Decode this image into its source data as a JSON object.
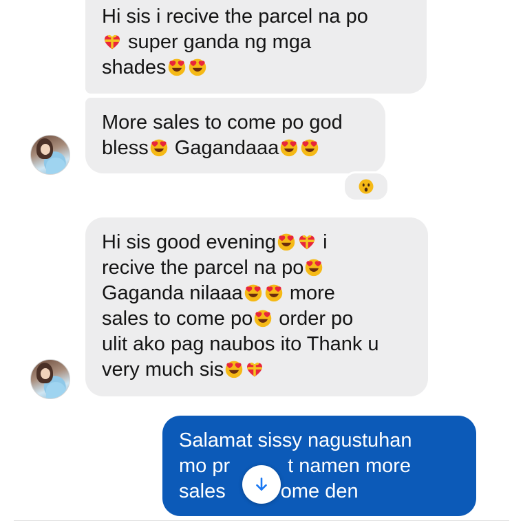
{
  "conversation": {
    "messages": [
      {
        "sender": "contact",
        "lines": [
          "Hi sis i recive the parcel na po",
          " super ganda ng mga",
          "shades"
        ]
      },
      {
        "sender": "contact",
        "lines": [
          "More sales to come po god",
          "bless",
          " Gagandaaa"
        ]
      },
      {
        "sender": "contact",
        "lines": [
          "Hi sis good evening",
          " i",
          "recive the parcel na po",
          "Gaganda nilaaa",
          " more",
          "sales to come po",
          " order po",
          "ulit ako pag naubos ito Thank u",
          "very much sis"
        ]
      },
      {
        "sender": "me",
        "lines": [
          "Salamat sissy nagustuhan",
          "mo pr",
          "t namen more",
          "sales ",
          "ome den"
        ]
      }
    ],
    "reaction": "surprised-face",
    "colors": {
      "incoming_bubble": "#ededee",
      "outgoing_bubble": "#0c5ab8",
      "outgoing_text": "#ffffff",
      "heart_eyes": "#f5b916",
      "heart": "#e8263a",
      "scroll_arrow": "#1877f2"
    },
    "icons": {
      "heart_eyes": "smiling-face-with-heart-eyes-icon",
      "gift_heart": "heart-with-ribbon-icon",
      "scroll": "arrow-down-icon"
    }
  }
}
